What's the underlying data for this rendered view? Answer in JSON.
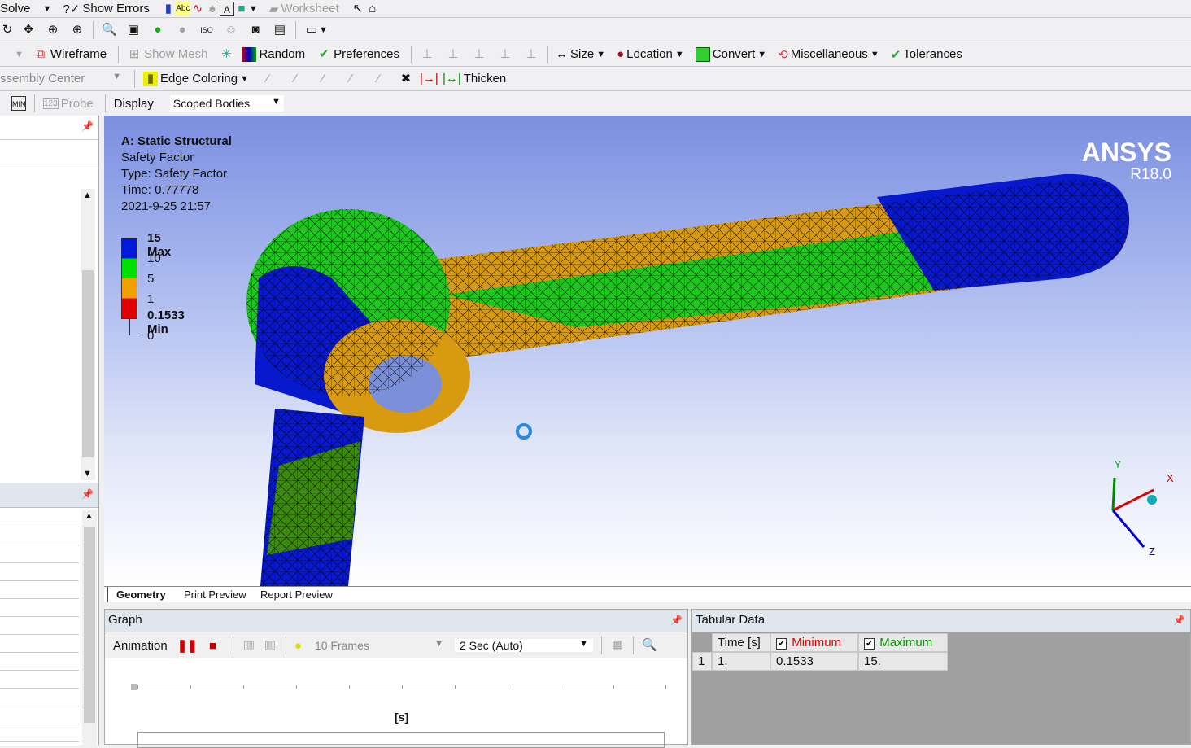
{
  "toolbar1": {
    "solve": "Solve",
    "show_errors": "Show Errors",
    "worksheet": "Worksheet"
  },
  "toolbar3": {
    "wireframe": "Wireframe",
    "show_mesh": "Show Mesh",
    "random": "Random",
    "preferences": "Preferences",
    "size": "Size",
    "location": "Location",
    "convert": "Convert",
    "miscellaneous": "Miscellaneous",
    "tolerances": "Tolerances"
  },
  "toolbar4": {
    "assembly_center": "ssembly Center",
    "edge_coloring": "Edge Coloring",
    "thicken": "Thicken"
  },
  "toolbar5": {
    "probe": "Probe",
    "display_label": "Display",
    "display_value": "Scoped Bodies"
  },
  "viewport": {
    "title": "A: Static Structural",
    "result": "Safety Factor",
    "type": "Type: Safety Factor",
    "time": "Time: 0.77778",
    "date": "2021-9-25 21:57",
    "brand": "ANSYS",
    "version": "R18.0",
    "legend": [
      {
        "label": "15 Max",
        "color": "#0018d8"
      },
      {
        "label": "10",
        "color": "#00e000"
      },
      {
        "label": "5",
        "color": "#f0a000"
      },
      {
        "label": "1",
        "color": "#e00000"
      },
      {
        "label": "0.1533 Min",
        "color": ""
      },
      {
        "label": "0",
        "color": ""
      }
    ],
    "axes": {
      "x": "X",
      "y": "Y",
      "z": "Z"
    }
  },
  "view_tabs": [
    "Geometry",
    "Print Preview",
    "Report Preview"
  ],
  "graph": {
    "title": "Graph",
    "animation": "Animation",
    "frames": "10 Frames",
    "duration": "2 Sec (Auto)",
    "axis_unit": "[s]"
  },
  "tabular": {
    "title": "Tabular Data",
    "headers": [
      "Time [s]",
      "Minimum",
      "Maximum"
    ],
    "rows": [
      {
        "index": "1",
        "time": "1.",
        "min": "0.1533",
        "max": "15."
      }
    ]
  }
}
